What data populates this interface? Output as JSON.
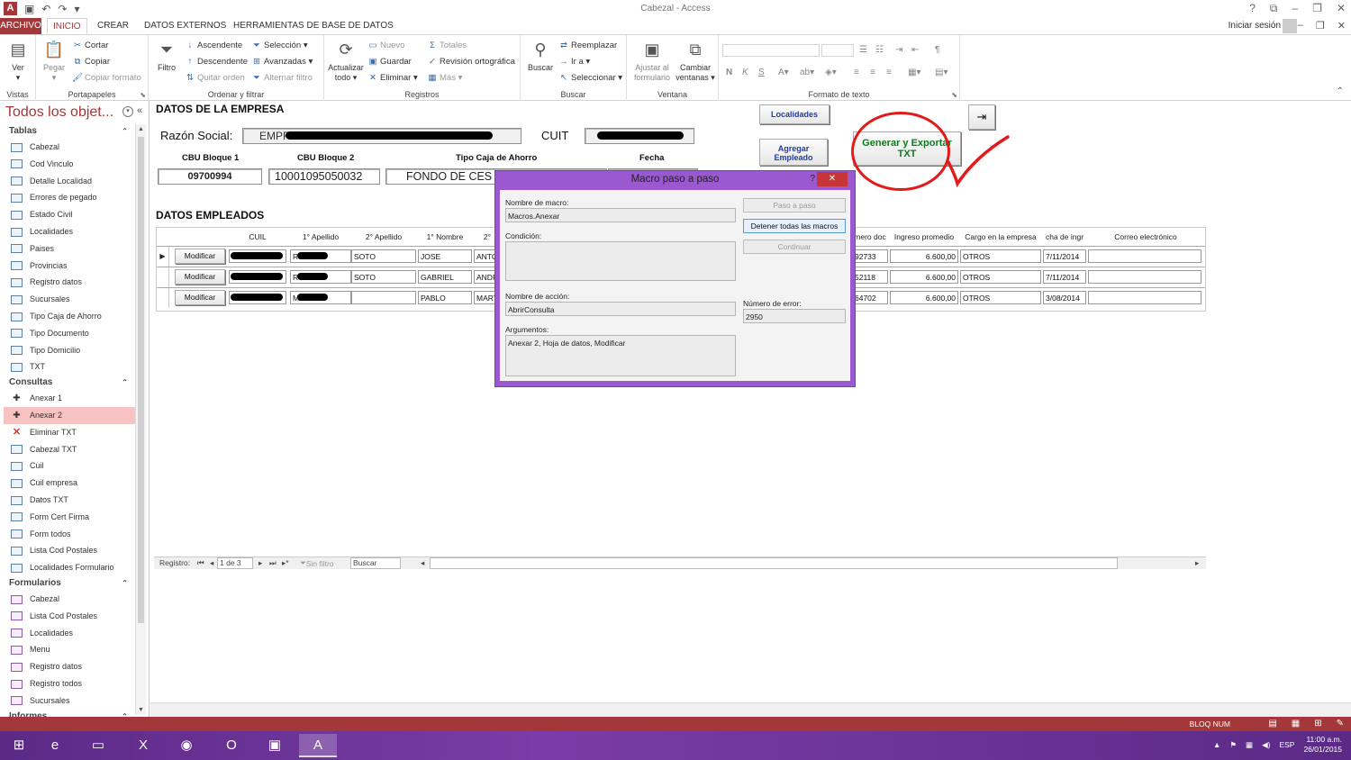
{
  "window": {
    "title": "Cabezal - Access",
    "signin": "Iniciar sesión",
    "help": "?",
    "minimize": "–",
    "restore": "❐",
    "close": "✕"
  },
  "ribbon_tabs": [
    "ARCHIVO",
    "INICIO",
    "CREAR",
    "DATOS EXTERNOS",
    "HERRAMIENTAS DE BASE DE DATOS"
  ],
  "ribbon": {
    "vistas": {
      "label": "Vistas",
      "ver": "Ver"
    },
    "portapapeles": {
      "label": "Portapapeles",
      "pegar": "Pegar",
      "cortar": "Cortar",
      "copiar": "Copiar",
      "copiar_formato": "Copiar formato"
    },
    "ordenar": {
      "label": "Ordenar y filtrar",
      "filtro": "Filtro",
      "ascendente": "Ascendente",
      "descendente": "Descendente",
      "quitar_orden": "Quitar orden",
      "seleccion": "Selección",
      "avanzadas": "Avanzadas",
      "alternar_filtro": "Alternar filtro"
    },
    "registros": {
      "label": "Registros",
      "actualizar": "Actualizar todo",
      "nuevo": "Nuevo",
      "guardar": "Guardar",
      "eliminar": "Eliminar",
      "totales": "Totales",
      "revision": "Revisión ortográfica",
      "mas": "Más"
    },
    "buscar": {
      "label": "Buscar",
      "buscar": "Buscar",
      "reemplazar": "Reemplazar",
      "ir_a": "Ir a",
      "seleccionar": "Seleccionar"
    },
    "ventana": {
      "label": "Ventana",
      "ajustar": "Ajustar al formulario",
      "cambiar": "Cambiar ventanas"
    },
    "formato": {
      "label": "Formato de texto",
      "bold": "N",
      "italic": "K",
      "underline": "S"
    }
  },
  "nav": {
    "header": "Todos los objet...",
    "sections": [
      {
        "title": "Tablas",
        "type": "table",
        "items": [
          "Cabezal",
          "Cod Vinculo",
          "Detalle Localidad",
          "Errores de pegado",
          "Estado Civil",
          "Localidades",
          "Paises",
          "Provincias",
          "Registro datos",
          "Sucursales",
          "Tipo Caja de Ahorro",
          "Tipo Documento",
          "Tipo Domicilio",
          "TXT"
        ]
      },
      {
        "title": "Consultas",
        "type": "query",
        "items": [
          "Anexar 1",
          "Anexar 2",
          "Eliminar TXT",
          "Cabezal TXT",
          "Cuil",
          "Cuil empresa",
          "Datos TXT",
          "Form Cert Firma",
          "Form todos",
          "Lista Cod Postales",
          "Localidades Formulario"
        ]
      },
      {
        "title": "Formularios",
        "type": "form",
        "items": [
          "Cabezal",
          "Lista Cod Postales",
          "Localidades",
          "Menu",
          "Registro datos",
          "Registro todos",
          "Sucursales"
        ]
      },
      {
        "title": "Informes",
        "type": "report",
        "items": []
      }
    ],
    "selected": "Anexar 2"
  },
  "form": {
    "heading_empresa": "DATOS DE LA EMPRESA",
    "razon_social_label": "Razón Social:",
    "razon_social_value": "EMPRESA SA",
    "cuit_label": "CUIT",
    "cbu1_label": "CBU Bloque 1",
    "cbu1_value": "09700994",
    "cbu2_label": "CBU Bloque 2",
    "cbu2_value": "10001095050032",
    "tipo_caja_label": "Tipo Caja de Ahorro",
    "tipo_caja_value": "FONDO DE CES",
    "fecha_label": "Fecha",
    "btn_localidades": "Localidades",
    "btn_agregar": "Agregar Empleado",
    "btn_generar": "Generar y Exportar TXT",
    "heading_empleados": "DATOS EMPLEADOS",
    "columns": [
      "CUIL",
      "1° Apellido",
      "2° Apellido",
      "1° Nombre",
      "2°",
      "mero doc",
      "Ingreso promedio",
      "Cargo en la empresa",
      "cha de ingr",
      "Correo electrónico"
    ],
    "row_button": "Modificar",
    "rows": [
      {
        "ap1": "ROCHA",
        "ap2": "SOTO",
        "n1": "JOSE",
        "n2": "ANTO",
        "doc": "92733",
        "ingreso": "6.600,00",
        "cargo": "OTROS",
        "fecha": "7/11/2014"
      },
      {
        "ap1": "RO",
        "ap2": "SOTO",
        "n1": "GABRIEL",
        "n2": "ANDR",
        "doc": "52118",
        "ingreso": "6.600,00",
        "cargo": "OTROS",
        "fecha": "7/11/2014"
      },
      {
        "ap1": "MARELM",
        "ap2": "",
        "n1": "PABLO",
        "n2": "MART",
        "doc": "64702",
        "ingreso": "6.600,00",
        "cargo": "OTROS",
        "fecha": "3/08/2014"
      }
    ],
    "recnav": {
      "label": "Registro:",
      "position": "1 de 3",
      "filter": "Sin filtro",
      "search": "Buscar"
    }
  },
  "modal": {
    "title": "Macro paso a paso",
    "help": "?",
    "close": "✕",
    "macro_name_label": "Nombre de macro:",
    "macro_name": "Macros.Anexar",
    "condition_label": "Condición:",
    "condition": "",
    "action_label": "Nombre de acción:",
    "action": "AbrirConsulta",
    "args_label": "Argumentos:",
    "args": "Anexar 2, Hoja de datos, Modificar",
    "error_label": "Número de error:",
    "error": "2950",
    "btn_step": "Paso a paso",
    "btn_stop": "Detener todas las macros",
    "btn_continue": "Continuar"
  },
  "status": {
    "num": "BLOQ NUM"
  },
  "taskbar": {
    "time": "11:00 a.m.",
    "date": "26/01/2015",
    "lang": "ESP"
  },
  "colors": {
    "accent": "#a4373a",
    "modal": "#9b59d0",
    "annotation": "#e21a1a",
    "taskbar": "#5b2a86"
  }
}
